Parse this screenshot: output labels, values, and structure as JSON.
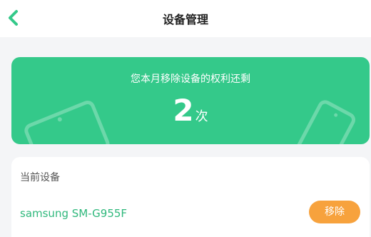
{
  "header": {
    "title": "设备管理",
    "back_icon": "chevron-left-icon",
    "accent_color": "#34c98a"
  },
  "banner": {
    "text": "您本月移除设备的权利还剩",
    "count": "2",
    "unit": "次",
    "background_color": "#34c98a",
    "decor_icons": [
      "tablet-icon",
      "phone-icon"
    ]
  },
  "current_device": {
    "label": "当前设备",
    "name": "samsung SM-G955F",
    "remove_label": "移除",
    "remove_color": "#f7a23d"
  }
}
